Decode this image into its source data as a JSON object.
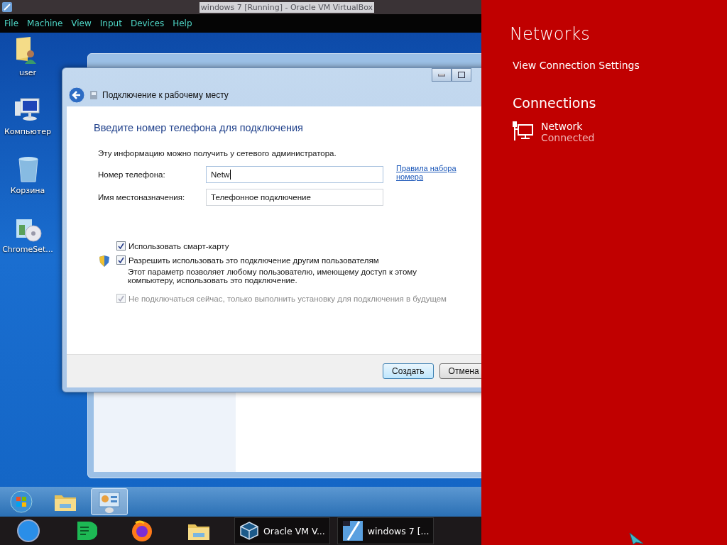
{
  "vm_window": {
    "title": "windows 7 [Running] - Oracle VM VirtualBox"
  },
  "menu": [
    "File",
    "Machine",
    "View",
    "Input",
    "Devices",
    "Help"
  ],
  "desktop_icons": [
    {
      "kind": "user-folder",
      "label": "user"
    },
    {
      "kind": "computer",
      "label": "Компьютер"
    },
    {
      "kind": "bin",
      "label": "Корзина"
    },
    {
      "kind": "installer",
      "label": "ChromeSet..."
    }
  ],
  "dialog": {
    "title": "Подключение к рабочему месту",
    "heading": "Введите номер телефона для подключения",
    "info": "Эту информацию можно получить у сетевого администратора.",
    "fields": [
      {
        "label": "Номер телефона:",
        "value": "Netw",
        "focused": true
      },
      {
        "label": "Имя местоназначения:",
        "value": "Телефонное подключение",
        "focused": false
      }
    ],
    "link": "Правила набора номера",
    "options": [
      {
        "label": "Использовать смарт-карту",
        "checked": true,
        "disabled": false,
        "shield": false
      },
      {
        "label": "Разрешить использовать это подключение другим пользователям",
        "checked": true,
        "disabled": false,
        "shield": true,
        "note": "Этот параметр позволяет любому пользователю, имеющему доступ к этому компьютеру, использовать это подключение."
      },
      {
        "label": "Не подключаться сейчас, только выполнить установку для подключения в будущем",
        "checked": true,
        "disabled": true,
        "shield": false
      }
    ],
    "buttons": [
      {
        "label": "Создать",
        "default": true
      },
      {
        "label": "Отмена",
        "default": false
      }
    ]
  },
  "guest_taskbar": [
    {
      "kind": "start",
      "selected": false
    },
    {
      "kind": "folder",
      "selected": false
    },
    {
      "kind": "control-panel",
      "selected": true
    }
  ],
  "host_taskbar": [
    {
      "kind": "orb"
    },
    {
      "kind": "chat"
    },
    {
      "kind": "firefox"
    },
    {
      "kind": "folder"
    },
    {
      "kind": "vbox-window",
      "label": "Oracle VM V..."
    },
    {
      "kind": "vm-window",
      "label": "windows 7 [..."
    }
  ],
  "networks_panel": {
    "title": "Networks",
    "settings_link": "View Connection Settings",
    "section": "Connections",
    "connections": [
      {
        "name": "Network",
        "status": "Connected"
      }
    ]
  }
}
